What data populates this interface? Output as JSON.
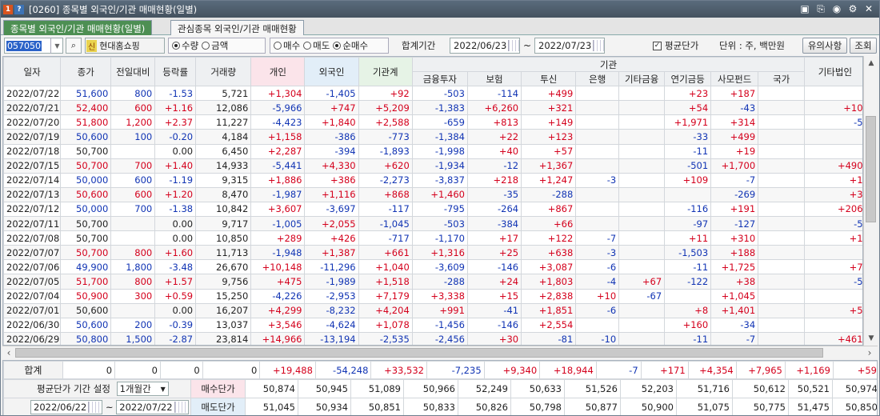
{
  "window": {
    "number_badge": "1",
    "help_badge": "?",
    "title": "[0260] 종목별 외국인/기관 매매현황(일별)",
    "tools": [
      "▣",
      "⎘",
      "◉",
      "⚙",
      "✕"
    ]
  },
  "tabs": [
    {
      "label": "종목별 외국인/기관 매매현황(일별)"
    },
    {
      "label": "관심종목 외국인/기관 매매현황"
    }
  ],
  "toolbar": {
    "stock_code": "057050",
    "stock_tag": "신",
    "stock_name": "현대홈쇼핑",
    "radio_group1": [
      {
        "label": "수량",
        "checked": true
      },
      {
        "label": "금액",
        "checked": false
      }
    ],
    "radio_group2": [
      {
        "label": "매수",
        "checked": false
      },
      {
        "label": "매도",
        "checked": false
      },
      {
        "label": "순매수",
        "checked": true
      }
    ],
    "period_label": "합계기간",
    "date_from": "2022/06/23",
    "date_to": "2022/07/23",
    "tilde": "~",
    "avg_price_label": "평균단가",
    "avg_price_checked": true,
    "unit_label": "단위 : 주, 백만원",
    "notice_button": "유의사항",
    "query_button": "조회"
  },
  "table": {
    "group_header": "기관",
    "headers": [
      "일자",
      "종가",
      "전일대비",
      "등락률",
      "거래량",
      "개인",
      "외국인",
      "기관계",
      "금융투자",
      "보험",
      "투신",
      "은행",
      "기타금융",
      "연기금등",
      "사모펀드",
      "국가",
      "기타법인",
      "기"
    ],
    "rows": [
      [
        "2022/07/22",
        "51,600",
        "800",
        "-1.53",
        "5,721",
        "+1,304",
        "-1,405",
        "+92",
        "-503",
        "-114",
        "+499",
        "",
        "",
        "+23",
        "+187",
        "",
        "",
        ""
      ],
      [
        "2022/07/21",
        "52,400",
        "600",
        "+1.16",
        "12,086",
        "-5,966",
        "+747",
        "+5,209",
        "-1,383",
        "+6,260",
        "+321",
        "",
        "",
        "+54",
        "-43",
        "",
        "+10",
        ""
      ],
      [
        "2022/07/20",
        "51,800",
        "1,200",
        "+2.37",
        "11,227",
        "-4,423",
        "+1,840",
        "+2,588",
        "-659",
        "+813",
        "+149",
        "",
        "",
        "+1,971",
        "+314",
        "",
        "-5",
        ""
      ],
      [
        "2022/07/19",
        "50,600",
        "100",
        "-0.20",
        "4,184",
        "+1,158",
        "-386",
        "-773",
        "-1,384",
        "+22",
        "+123",
        "",
        "",
        "-33",
        "+499",
        "",
        "",
        ""
      ],
      [
        "2022/07/18",
        "50,700",
        "",
        "0.00",
        "6,450",
        "+2,287",
        "-394",
        "-1,893",
        "-1,998",
        "+40",
        "+57",
        "",
        "",
        "-11",
        "+19",
        "",
        "",
        ""
      ],
      [
        "2022/07/15",
        "50,700",
        "700",
        "+1.40",
        "14,933",
        "-5,441",
        "+4,330",
        "+620",
        "-1,934",
        "-12",
        "+1,367",
        "",
        "",
        "-501",
        "+1,700",
        "",
        "+490",
        ""
      ],
      [
        "2022/07/14",
        "50,000",
        "600",
        "-1.19",
        "9,315",
        "+1,886",
        "+386",
        "-2,273",
        "-3,837",
        "+218",
        "+1,247",
        "-3",
        "",
        "+109",
        "-7",
        "",
        "+1",
        ""
      ],
      [
        "2022/07/13",
        "50,600",
        "600",
        "+1.20",
        "8,470",
        "-1,987",
        "+1,116",
        "+868",
        "+1,460",
        "-35",
        "-288",
        "",
        "",
        "",
        "-269",
        "",
        "+3",
        ""
      ],
      [
        "2022/07/12",
        "50,000",
        "700",
        "-1.38",
        "10,842",
        "+3,607",
        "-3,697",
        "-117",
        "-795",
        "-264",
        "+867",
        "",
        "",
        "-116",
        "+191",
        "",
        "+206",
        ""
      ],
      [
        "2022/07/11",
        "50,700",
        "",
        "0.00",
        "9,717",
        "-1,005",
        "+2,055",
        "-1,045",
        "-503",
        "-384",
        "+66",
        "",
        "",
        "-97",
        "-127",
        "",
        "-5",
        ""
      ],
      [
        "2022/07/08",
        "50,700",
        "",
        "0.00",
        "10,850",
        "+289",
        "+426",
        "-717",
        "-1,170",
        "+17",
        "+122",
        "-7",
        "",
        "+11",
        "+310",
        "",
        "+1",
        ""
      ],
      [
        "2022/07/07",
        "50,700",
        "800",
        "+1.60",
        "11,713",
        "-1,948",
        "+1,387",
        "+661",
        "+1,316",
        "+25",
        "+638",
        "-3",
        "",
        "-1,503",
        "+188",
        "",
        "",
        ""
      ],
      [
        "2022/07/06",
        "49,900",
        "1,800",
        "-3.48",
        "26,670",
        "+10,148",
        "-11,296",
        "+1,040",
        "-3,609",
        "-146",
        "+3,087",
        "-6",
        "",
        "-11",
        "+1,725",
        "",
        "+7",
        ""
      ],
      [
        "2022/07/05",
        "51,700",
        "800",
        "+1.57",
        "9,756",
        "+475",
        "-1,989",
        "+1,518",
        "-288",
        "+24",
        "+1,803",
        "-4",
        "+67",
        "-122",
        "+38",
        "",
        "-5",
        ""
      ],
      [
        "2022/07/04",
        "50,900",
        "300",
        "+0.59",
        "15,250",
        "-4,226",
        "-2,953",
        "+7,179",
        "+3,338",
        "+15",
        "+2,838",
        "+10",
        "-67",
        "",
        "+1,045",
        "",
        "",
        ""
      ],
      [
        "2022/07/01",
        "50,600",
        "",
        "0.00",
        "16,207",
        "+4,299",
        "-8,232",
        "+4,204",
        "+991",
        "-41",
        "+1,851",
        "-6",
        "",
        "+8",
        "+1,401",
        "",
        "+5",
        ""
      ],
      [
        "2022/06/30",
        "50,600",
        "200",
        "-0.39",
        "13,037",
        "+3,546",
        "-4,624",
        "+1,078",
        "-1,456",
        "-146",
        "+2,554",
        "",
        "",
        "+160",
        "-34",
        "",
        "",
        ""
      ],
      [
        "2022/06/29",
        "50,800",
        "1,500",
        "-2.87",
        "23,814",
        "+14,966",
        "-13,194",
        "-2,535",
        "-2,456",
        "+30",
        "-81",
        "-10",
        "",
        "-11",
        "-7",
        "",
        "+461",
        ""
      ]
    ],
    "change_direction": [
      "down",
      "up",
      "up",
      "down",
      "flat",
      "up",
      "down",
      "up",
      "down",
      "flat",
      "flat",
      "up",
      "down",
      "up",
      "up",
      "flat",
      "down",
      "down"
    ]
  },
  "totals": {
    "label": "합계",
    "cells": [
      "0",
      "0",
      "0",
      "0",
      "+19,488",
      "-54,248",
      "+33,532",
      "-7,235",
      "+9,340",
      "+18,944",
      "-7",
      "+171",
      "+4,354",
      "+7,965",
      "+1,169",
      "+59"
    ]
  },
  "avg_panel": {
    "setting_label": "평균단가 기간 설정",
    "period_option": "1개월간",
    "date_from": "2022/06/22",
    "date_to": "2022/07/22",
    "tilde": "~",
    "buy_label": "매수단가",
    "sell_label": "매도단가",
    "buy_values": [
      "50,874",
      "50,945",
      "51,089",
      "50,966",
      "52,249",
      "50,633",
      "51,526",
      "52,203",
      "51,716",
      "50,612",
      "50,521",
      "50,974"
    ],
    "sell_values": [
      "51,045",
      "50,934",
      "50,851",
      "50,833",
      "50,826",
      "50,798",
      "50,877",
      "50,900",
      "51,075",
      "50,775",
      "51,475",
      "50,850"
    ]
  },
  "colors": {
    "up": "#d4001c",
    "down": "#1134b4",
    "active_tab": "#4d8f53",
    "individual_header": "#fbe4ea",
    "foreign_header": "#e2eef8",
    "institution_header": "#e6f3e6"
  }
}
